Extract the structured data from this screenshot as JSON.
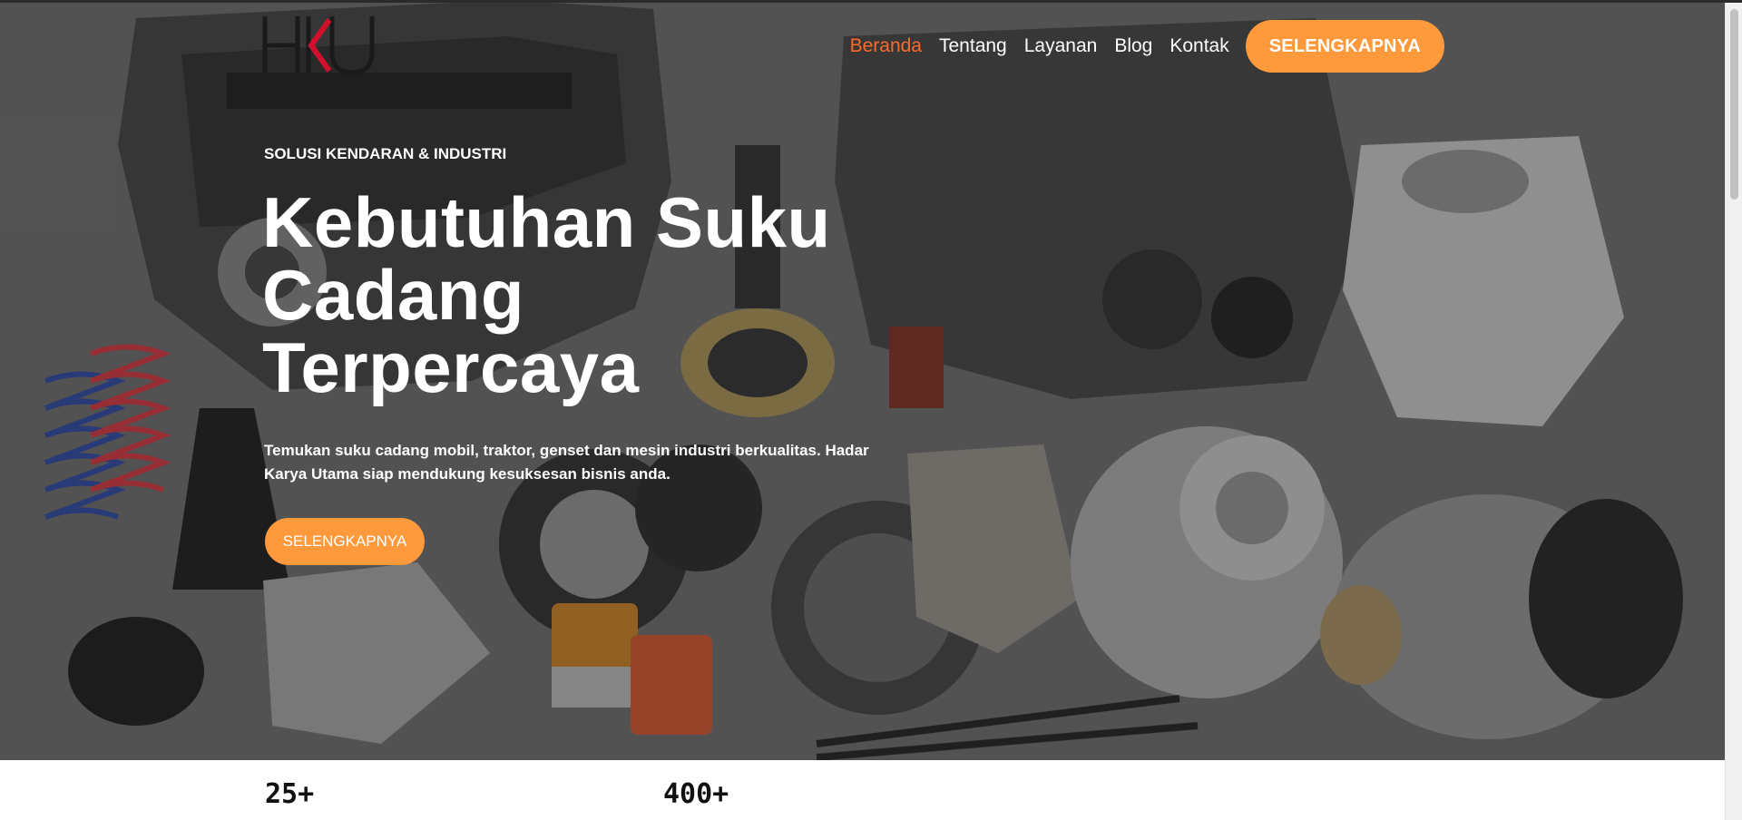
{
  "header": {
    "logo_text": "HKU",
    "nav": [
      {
        "label": "Beranda",
        "active": true
      },
      {
        "label": "Tentang",
        "active": false
      },
      {
        "label": "Layanan",
        "active": false
      },
      {
        "label": "Blog",
        "active": false
      },
      {
        "label": "Kontak",
        "active": false
      }
    ],
    "cta_label": "SELENGKAPNYA"
  },
  "hero": {
    "eyebrow": "SOLUSI KENDARAN & INDUSTRI",
    "headline": "Kebutuhan Suku Cadang Terpercaya",
    "description": "Temukan suku cadang mobil, traktor, genset dan mesin industri berkualitas. Hadar Karya Utama siap mendukung kesuksesan bisnis anda.",
    "button_label": "SELENGKAPNYA"
  },
  "stats": [
    {
      "value": "25+"
    },
    {
      "value": "400+"
    }
  ],
  "colors": {
    "accent": "#ff9a3c",
    "nav_active": "#ff6a2b",
    "logo_red": "#d3102b"
  },
  "icons": [
    "logo-mark",
    "engine-parts-illustration"
  ]
}
